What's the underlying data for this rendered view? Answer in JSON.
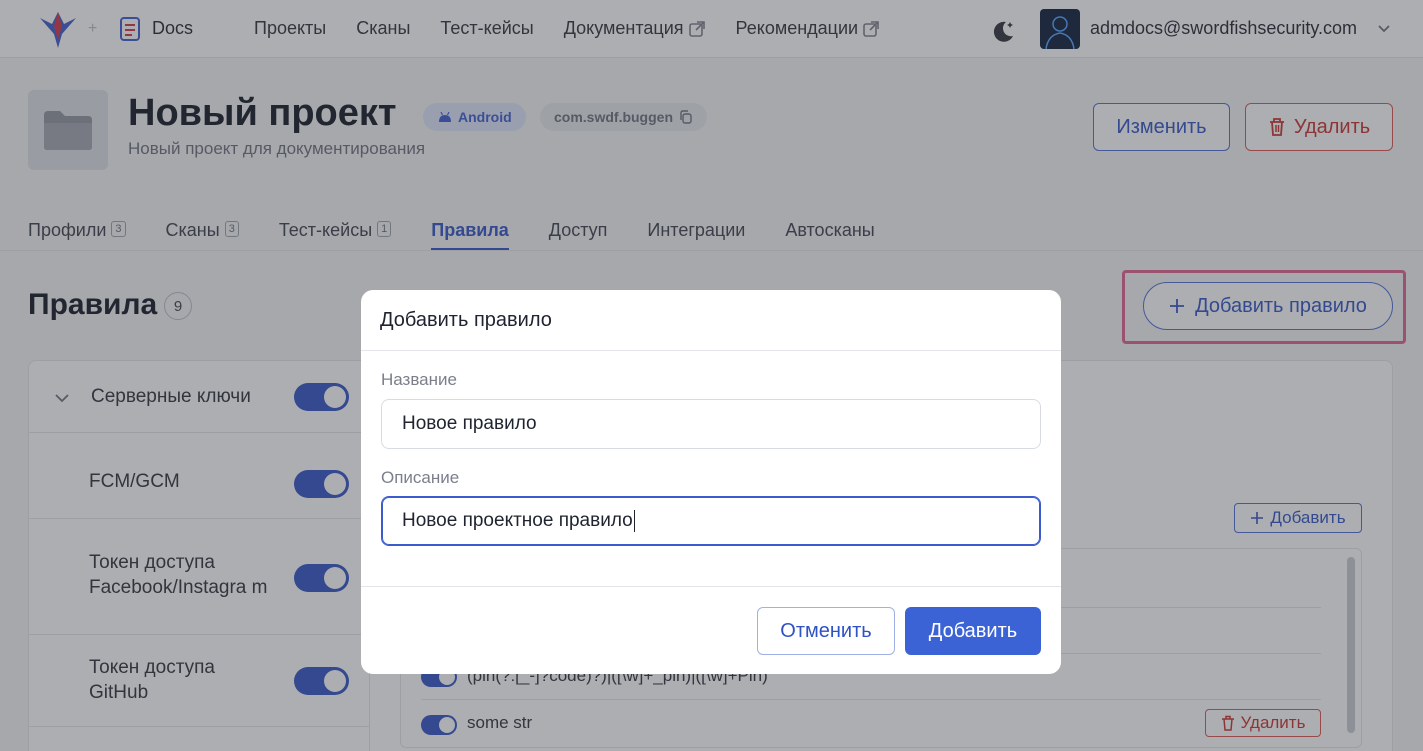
{
  "header": {
    "product_name": "Docs",
    "nav": [
      {
        "label": "Проекты",
        "external": false
      },
      {
        "label": "Сканы",
        "external": false
      },
      {
        "label": "Тест-кейсы",
        "external": false
      },
      {
        "label": "Документация",
        "external": true
      },
      {
        "label": "Рекомендации",
        "external": true
      }
    ],
    "user_email": "admdocs@swordfishsecurity.com"
  },
  "project": {
    "title": "Новый проект",
    "platform_badge": "Android",
    "package_badge": "com.swdf.buggen",
    "description": "Новый проект для документирования",
    "edit_label": "Изменить",
    "delete_label": "Удалить"
  },
  "tabs": [
    {
      "label": "Профили",
      "count": "3"
    },
    {
      "label": "Сканы",
      "count": "3"
    },
    {
      "label": "Тест-кейсы",
      "count": "1"
    },
    {
      "label": "Правила",
      "count": null,
      "active": true
    },
    {
      "label": "Доступ",
      "count": null
    },
    {
      "label": "Интеграции",
      "count": null
    },
    {
      "label": "Автосканы",
      "count": null
    }
  ],
  "rules": {
    "title": "Правила",
    "count": "9",
    "add_rule_label": "Добавить правило",
    "groups": [
      {
        "label": "Серверные ключи",
        "enabled": true
      },
      {
        "label": "FCM/GCM",
        "enabled": true
      },
      {
        "label": "Токен доступа Facebook/Instagra m",
        "enabled": true
      },
      {
        "label": "Токен доступа GitHub",
        "enabled": true
      }
    ],
    "add_label": "Добавить",
    "patterns": [
      {
        "text": "(pin(?:[_-]?code)?)|([\\w]+_pin)|([\\w]+Pin)",
        "enabled": true
      },
      {
        "text": "some str",
        "enabled": true
      }
    ],
    "pattern_delete_label": "Удалить"
  },
  "modal": {
    "title": "Добавить правило",
    "name_label": "Название",
    "name_value": "Новое правило",
    "desc_label": "Описание",
    "desc_value": "Новое проектное правило",
    "cancel_label": "Отменить",
    "submit_label": "Добавить"
  },
  "colors": {
    "accent": "#3b63d6",
    "danger": "#c8302b",
    "highlight": "#e0608f"
  }
}
